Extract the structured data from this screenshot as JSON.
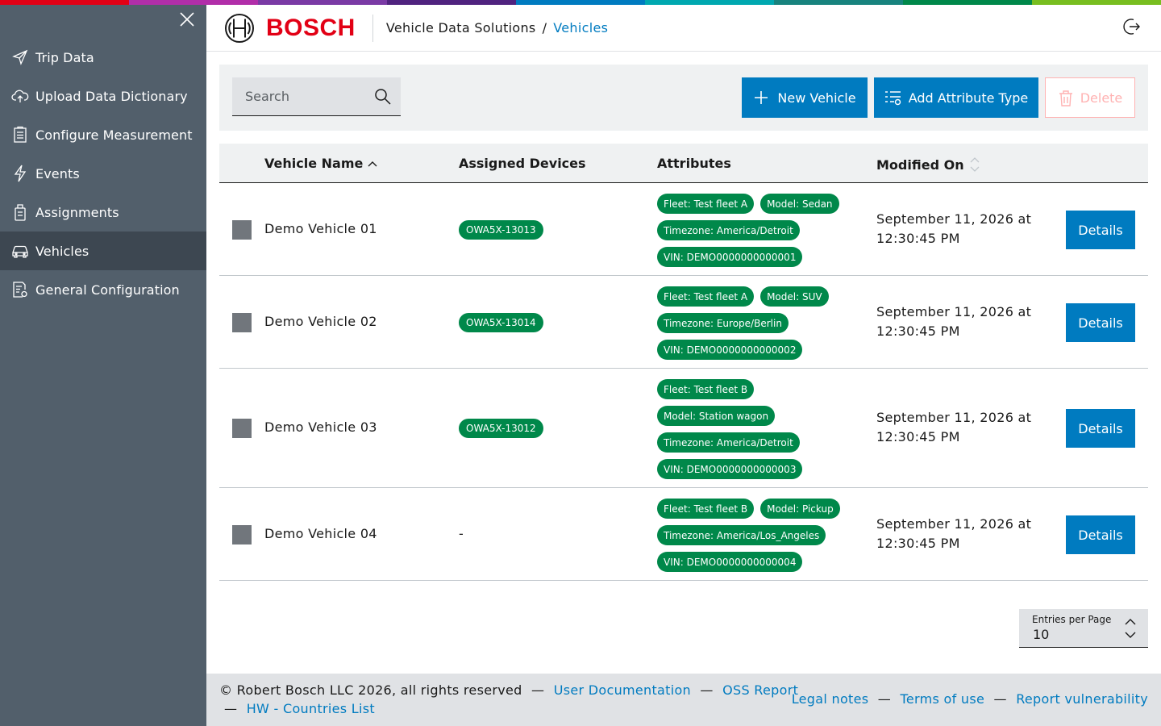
{
  "colors": {
    "sidebar": "#525f6b",
    "sidebar_active": "#3d4751",
    "primary": "#007bc0",
    "tag_green": "#00884a",
    "bosch_red": "#e20015",
    "supergraphic": [
      "#e20015",
      "#b12ea9",
      "#7a3aa5",
      "#50237f",
      "#007bc0",
      "#00a8b0",
      "#18837e",
      "#00884a",
      "#78be20"
    ]
  },
  "sidebar": {
    "close_icon": "close-icon",
    "items": [
      {
        "label": "Trip Data",
        "icon": "paper-plane-icon",
        "active": false
      },
      {
        "label": "Upload Data Dictionary",
        "icon": "cloud-upload-icon",
        "active": false
      },
      {
        "label": "Configure Measurement",
        "icon": "clipboard-list-icon",
        "active": false
      },
      {
        "label": "Events",
        "icon": "lightning-icon",
        "active": false
      },
      {
        "label": "Assignments",
        "icon": "device-assign-icon",
        "active": true
      },
      {
        "label": "Vehicles",
        "icon": "car-icon",
        "active": true
      },
      {
        "label": "General Configuration",
        "icon": "config-doc-icon",
        "active": false
      }
    ]
  },
  "header": {
    "brand": "BOSCH",
    "breadcrumb_root": "Vehicle Data Solutions",
    "breadcrumb_sep": "/",
    "breadcrumb_current": "Vehicles",
    "logout_icon": "logout-icon"
  },
  "toolbar": {
    "search_placeholder": "Search",
    "new_vehicle": "New Vehicle",
    "add_attribute_type": "Add Attribute Type",
    "delete": "Delete"
  },
  "table": {
    "columns": {
      "name": "Vehicle Name",
      "devices": "Assigned Devices",
      "attributes": "Attributes",
      "modified": "Modified On"
    },
    "sort": {
      "column": "Vehicle Name",
      "direction": "ascending"
    },
    "rows": [
      {
        "name": "Demo Vehicle 01",
        "device": "OWA5X-13013",
        "attributes": [
          [
            "Fleet: Test fleet A",
            "Model: Sedan"
          ],
          [
            "Timezone: America/Detroit"
          ],
          [
            "VIN: DEMO0000000000001"
          ]
        ],
        "modified_line1": "September 11, 2026 at",
        "modified_line2": "12:30:45 PM",
        "details": "Details"
      },
      {
        "name": "Demo Vehicle 02",
        "device": "OWA5X-13014",
        "attributes": [
          [
            "Fleet: Test fleet A",
            "Model: SUV"
          ],
          [
            "Timezone: Europe/Berlin"
          ],
          [
            "VIN: DEMO0000000000002"
          ]
        ],
        "modified_line1": "September 11, 2026 at",
        "modified_line2": "12:30:45 PM",
        "details": "Details"
      },
      {
        "name": "Demo Vehicle 03",
        "device": "OWA5X-13012",
        "attributes": [
          [
            "Fleet: Test fleet B"
          ],
          [
            "Model: Station wagon"
          ],
          [
            "Timezone: America/Detroit"
          ],
          [
            "VIN: DEMO0000000000003"
          ]
        ],
        "modified_line1": "September 11, 2026 at",
        "modified_line2": "12:30:45 PM",
        "details": "Details"
      },
      {
        "name": "Demo Vehicle 04",
        "device": "-",
        "attributes": [
          [
            "Fleet: Test fleet B",
            "Model: Pickup"
          ],
          [
            "Timezone: America/Los_Angeles"
          ],
          [
            "VIN: DEMO0000000000004"
          ]
        ],
        "modified_line1": "September 11, 2026 at",
        "modified_line2": "12:30:45 PM",
        "details": "Details"
      }
    ]
  },
  "pager": {
    "label": "Entries per Page",
    "value": "10"
  },
  "footer": {
    "copyright": "© Robert Bosch LLC 2026, all rights reserved",
    "dash": "—",
    "user_docs": "User Documentation",
    "oss_report": "OSS Report",
    "hw_countries": "HW - Countries List",
    "legal": "Legal notes",
    "terms": "Terms of use",
    "vulnerability": "Report vulnerability"
  }
}
